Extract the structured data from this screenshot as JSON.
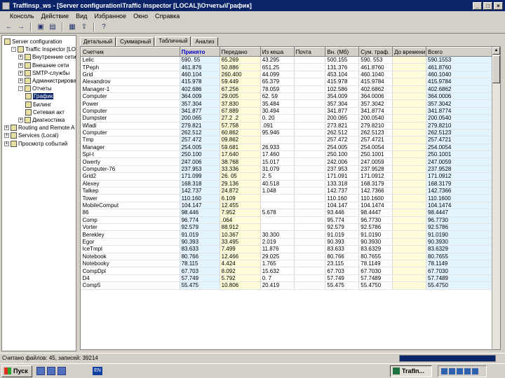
{
  "window": {
    "title": "Traffinsp_ws - [Server configuration\\Traffic Inspector [LOCAL]\\Отчеты\\График]"
  },
  "menu": [
    "Консоль",
    "Действие",
    "Вид",
    "Избранное",
    "Окно",
    "Справка"
  ],
  "toolbar": [
    "back-arrow-icon",
    "forward-arrow-icon",
    "up-folder-icon",
    "console-tree-icon",
    "properties-icon",
    "export-icon",
    "help-icon"
  ],
  "tree": [
    {
      "label": "Server configuration",
      "level": 0,
      "exp": "",
      "sel": false
    },
    {
      "label": "Traffic Inspector [LOC",
      "level": 1,
      "exp": "-",
      "sel": false
    },
    {
      "label": "Внутренние сети",
      "level": 2,
      "exp": "+",
      "sel": false
    },
    {
      "label": "Внешние сети",
      "level": 2,
      "exp": "+",
      "sel": false
    },
    {
      "label": "SMTP-службы",
      "level": 2,
      "exp": "+",
      "sel": false
    },
    {
      "label": "Администрирован",
      "level": 2,
      "exp": "+",
      "sel": false
    },
    {
      "label": "Отчеты",
      "level": 2,
      "exp": "-",
      "sel": false
    },
    {
      "label": "График",
      "level": 3,
      "exp": "",
      "sel": true
    },
    {
      "label": "Билинг",
      "level": 3,
      "exp": "",
      "sel": false
    },
    {
      "label": "Сетевая акт",
      "level": 3,
      "exp": "",
      "sel": false
    },
    {
      "label": "Диагностика",
      "level": 2,
      "exp": "+",
      "sel": false
    },
    {
      "label": "Routing and Remote A",
      "level": 0,
      "exp": "+",
      "sel": false
    },
    {
      "label": "Services (Local)",
      "level": 0,
      "exp": "+",
      "sel": false
    },
    {
      "label": "Просмотр событий",
      "level": 0,
      "exp": "+",
      "sel": false
    }
  ],
  "tabs": [
    {
      "label": "Детальный",
      "active": false
    },
    {
      "label": "Суммарный",
      "active": false
    },
    {
      "label": "Табличный",
      "active": true
    },
    {
      "label": "Анализ",
      "active": false
    }
  ],
  "columns": [
    "Счетчик",
    "Принято",
    "Передано",
    "Из кеша",
    "Почта",
    "Вн. (Мб)",
    "Сум. траф.",
    "До времени",
    "Всего"
  ],
  "rows": [
    [
      "Lelic",
      "590. 55",
      "65.269",
      "43.295",
      "",
      "500.155",
      "590. 553",
      "",
      "590.1553"
    ],
    [
      "TPeph",
      "461.876",
      "50.886",
      "651.25",
      "",
      "131.376",
      "461.8760",
      "",
      "461.8760"
    ],
    [
      "Grid",
      "460.104",
      "260.400",
      "44.099",
      "",
      "453.104",
      "460.1040",
      "",
      "460.1040"
    ],
    [
      "Alexandrov",
      "415.978",
      "59.449",
      "65.379",
      "",
      "415.978",
      "415.9784",
      "",
      "415.9784"
    ],
    [
      "Manager-1",
      "402.686",
      "67.256",
      "78.059",
      "",
      "102.586",
      "402.6862",
      "",
      "402.6862"
    ],
    [
      "Computer",
      "364.009",
      "29.005",
      "62. 59",
      "",
      "354.009",
      "364.0006",
      "",
      "364.0006"
    ],
    [
      "Power",
      "357.304",
      "37.830",
      "35.484",
      "",
      "357.304",
      "357.3042",
      "",
      "357.3042"
    ],
    [
      "Computer",
      "341.877",
      "67.889",
      "30.494",
      "",
      "341.877",
      "341.8774",
      "",
      "341.8774"
    ],
    [
      "Dumpster",
      "200.065",
      "27.2 .2",
      "0. 20",
      "",
      "200.065",
      "200.0540",
      "",
      "200.0540"
    ],
    [
      "Wladi",
      "279.821",
      "57.758",
      ".091",
      "",
      "273.821",
      "279.8210",
      "",
      "279.8210"
    ],
    [
      "Computer",
      "262.512",
      "60.862",
      "95.946",
      "",
      "262.512",
      "262.5123",
      "",
      "262.5123"
    ],
    [
      "Tmp",
      "257.472",
      "09.862",
      "",
      "",
      "257.472",
      "257.4721",
      "",
      "257.4721"
    ],
    [
      "Manager",
      "254.005",
      "59.681",
      "26.933",
      "",
      "254.005",
      "254.0054",
      "",
      "254.0054"
    ],
    [
      "Spl-t",
      "250.100",
      "17.640",
      "17.460",
      "",
      "250.100",
      "250.1001",
      "",
      "250.1001"
    ],
    [
      "Owerty",
      "247.006",
      "38.768",
      "15.017",
      "",
      "242.006",
      "247.0059",
      "",
      "247.0059"
    ],
    [
      "Computer-76",
      "237.953",
      "33.336",
      "31.079",
      "",
      "237.953",
      "237.9528",
      "",
      "237.9528"
    ],
    [
      "Grid2",
      "171.099",
      "26. 05",
      "2. 5",
      "",
      "171.091",
      "171.0912",
      "",
      "171.0912"
    ],
    [
      "Alexey",
      "168.318",
      "29.136",
      "40.518",
      "",
      "133.318",
      "168.3179",
      "",
      "168.3179"
    ],
    [
      "Talkep",
      "142.737",
      "24.872",
      "1.048",
      "",
      "142.737",
      "142.7366",
      "",
      "142.7366"
    ],
    [
      "Tower",
      "110.160",
      "6.109",
      "",
      "",
      "110.160",
      "110.1600",
      "",
      "110.1600"
    ],
    [
      "MobileComput",
      "104.147",
      "12.455",
      "",
      "",
      "104.147",
      "104.1474",
      "",
      "104.1474"
    ],
    [
      "86",
      "98.446",
      "7.952",
      "5.678",
      "",
      "93.446",
      "98.4447",
      "",
      "98.4447"
    ],
    [
      "Comp",
      "96.774",
      ".064",
      "",
      "",
      "95.774",
      "96.7730",
      "",
      "96.7730"
    ],
    [
      "Vorter",
      "92.579",
      "88.912",
      "",
      "",
      "92.579",
      "92.5786",
      "",
      "92.5786"
    ],
    [
      "Berekley",
      "91.019",
      "10.367",
      "30.300",
      "",
      "91.019",
      "91.0190",
      "",
      "91.0190"
    ],
    [
      "Egor",
      "90.393",
      "33.495",
      "2.019",
      "",
      "90.393",
      "90.3930",
      "",
      "90.3930"
    ],
    [
      "IceTmpl",
      "83.633",
      "7.499",
      "11.876",
      "",
      "83.633",
      "83.6329",
      "",
      "83.6329"
    ],
    [
      "Notebook",
      "80.766",
      "12.466",
      "29.025",
      "",
      "80.766",
      "80.7655",
      "",
      "80.7655"
    ],
    [
      "Notebooky",
      "78.115",
      "4.424",
      "1.765",
      "",
      "23.115",
      "78.1149",
      "",
      "78.1149"
    ],
    [
      "CompDpl",
      "67.703",
      "8.092",
      "15.632",
      "",
      "67.703",
      "67.7030",
      "",
      "67.7030"
    ],
    [
      "D4",
      "57.749",
      "5.792",
      "0. 7",
      "",
      "57.749",
      "57.7489",
      "",
      "57.7489"
    ],
    [
      "Comp5",
      "55.475",
      "10.806",
      "20.419",
      "",
      "55.475",
      "55.4750",
      "",
      "55.4750"
    ]
  ],
  "status": {
    "text": "Считано файлов: 45, записей: 39214",
    "progress_fraction": 1.0
  },
  "taskbar": {
    "start_label": "Пуск",
    "lang": "EN",
    "task_label": "TrafIn..."
  }
}
